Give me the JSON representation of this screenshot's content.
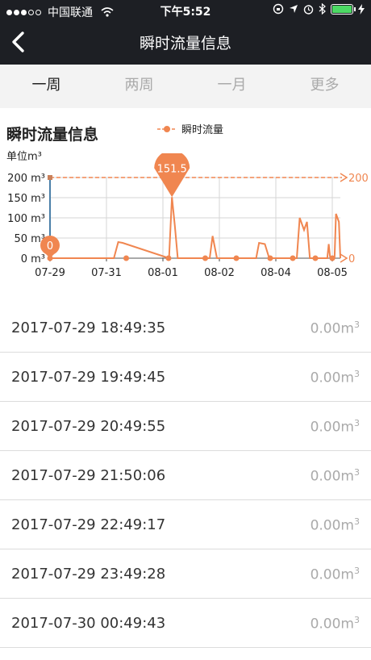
{
  "status": {
    "carrier": "中国联通",
    "time": "下午5:52"
  },
  "nav": {
    "title": "瞬时流量信息"
  },
  "tabs": [
    {
      "label": "一周",
      "active": true
    },
    {
      "label": "两周",
      "active": false
    },
    {
      "label": "一月",
      "active": false
    },
    {
      "label": "更多",
      "active": false
    }
  ],
  "chart": {
    "title": "瞬时流量信息",
    "unit": "单位m³",
    "legend": "瞬时流量"
  },
  "chart_data": {
    "type": "line",
    "title": "瞬时流量信息",
    "ylabel": "单位m³",
    "y_ticks": [
      "200 m³",
      "150 m³",
      "100 m³",
      "50 m³",
      "0 m³"
    ],
    "right_ticks": [
      "200",
      "0"
    ],
    "ylim": [
      0,
      200
    ],
    "x_labels": [
      "07-29",
      "07-31",
      "08-01",
      "08-02",
      "08-04",
      "08-05"
    ],
    "series": [
      {
        "name": "瞬时流量",
        "color": "#f08650",
        "x": [
          0,
          0.05,
          0.2,
          0.24,
          0.27,
          0.3,
          0.33,
          0.38,
          0.42,
          0.45,
          0.48,
          0.52,
          0.55,
          0.57,
          0.6,
          0.63,
          0.66,
          0.7,
          0.73,
          0.76,
          0.78,
          0.8,
          0.82,
          0.84,
          0.86,
          0.88,
          0.9,
          0.92,
          0.94,
          0.96,
          0.98,
          0.99,
          1.0
        ],
        "y": [
          0,
          0,
          0,
          0,
          0,
          0,
          0,
          0,
          0,
          0,
          0,
          0,
          0,
          0,
          0,
          0,
          0,
          0,
          0,
          0,
          0,
          0,
          0,
          0,
          0,
          0,
          0,
          0,
          0,
          0,
          0,
          0,
          0
        ]
      }
    ],
    "markers": [
      {
        "label": "151.5",
        "value": 151.5
      },
      {
        "label": "0",
        "value": 0
      }
    ],
    "max_line": 200
  },
  "records": [
    {
      "time": "2017-07-29 18:49:35",
      "value": "0.00m",
      "unit_sup": "3"
    },
    {
      "time": "2017-07-29 19:49:45",
      "value": "0.00m",
      "unit_sup": "3"
    },
    {
      "time": "2017-07-29 20:49:55",
      "value": "0.00m",
      "unit_sup": "3"
    },
    {
      "time": "2017-07-29 21:50:06",
      "value": "0.00m",
      "unit_sup": "3"
    },
    {
      "time": "2017-07-29 22:49:17",
      "value": "0.00m",
      "unit_sup": "3"
    },
    {
      "time": "2017-07-29 23:49:28",
      "value": "0.00m",
      "unit_sup": "3"
    },
    {
      "time": "2017-07-30 00:49:43",
      "value": "0.00m",
      "unit_sup": "3"
    }
  ]
}
